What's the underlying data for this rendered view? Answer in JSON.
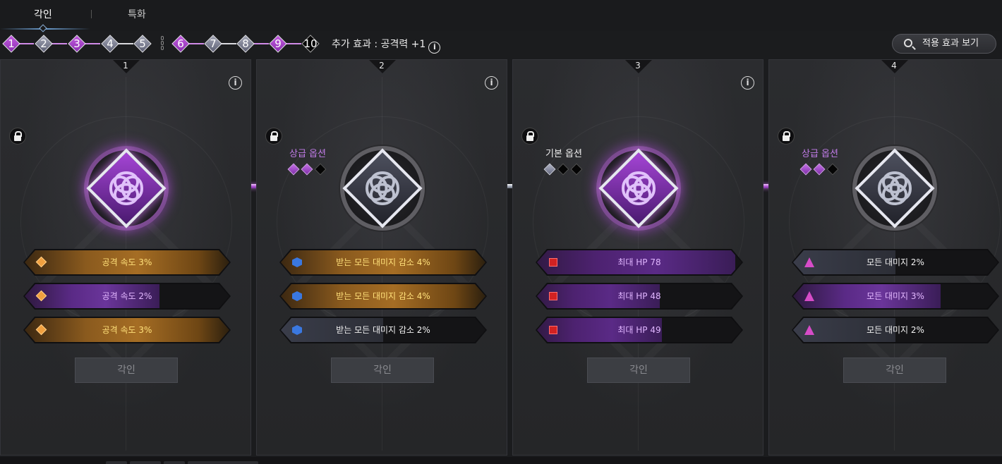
{
  "tabs": [
    {
      "label": "각인",
      "active": true
    },
    {
      "label": "특화",
      "active": false
    }
  ],
  "levels": [
    {
      "num": "1",
      "style": "purple"
    },
    {
      "num": "2",
      "style": "grey"
    },
    {
      "num": "3",
      "style": "purple"
    },
    {
      "num": "4",
      "style": "grey"
    },
    {
      "num": "5",
      "style": "grey"
    },
    {
      "num": "6",
      "style": "purple"
    },
    {
      "num": "7",
      "style": "grey"
    },
    {
      "num": "8",
      "style": "grey"
    },
    {
      "num": "9",
      "style": "purple"
    },
    {
      "num": "10",
      "style": "dark"
    }
  ],
  "bonus": {
    "text": "추가 효과 : 공격력 +1",
    "info": "i"
  },
  "view_button": {
    "label": "적용 효과 보기",
    "icon": "search-icon"
  },
  "panels": [
    {
      "number": "1",
      "info": "i",
      "locked": true,
      "option_label": "",
      "emblem": "purple",
      "gems": [],
      "rows": [
        {
          "text": "공격 속도 3%",
          "style": "gold",
          "icon": "diamond-icon",
          "fill": 1.0
        },
        {
          "text": "공격 속도 2%",
          "style": "violet",
          "icon": "diamond-icon",
          "fill": 0.66
        },
        {
          "text": "공격 속도 3%",
          "style": "gold",
          "icon": "diamond-icon",
          "fill": 1.0
        }
      ],
      "button": "각인"
    },
    {
      "number": "2",
      "info": "i",
      "locked": true,
      "option_label": "상급 옵션",
      "option_style": "hi",
      "emblem": "grey",
      "gems": [
        "p",
        "p",
        "k"
      ],
      "rows": [
        {
          "text": "받는 모든 대미지 감소 4%",
          "style": "gold",
          "icon": "hexagon-icon",
          "fill": 1.0
        },
        {
          "text": "받는 모든 대미지 감소 4%",
          "style": "gold",
          "icon": "hexagon-icon",
          "fill": 1.0
        },
        {
          "text": "받는 모든 대미지 감소 2%",
          "style": "plain",
          "icon": "hexagon-icon",
          "fill": 0.5
        }
      ],
      "button": "각인"
    },
    {
      "number": "3",
      "info": "i",
      "locked": true,
      "option_label": "기본 옵션",
      "option_style": "base",
      "emblem": "purple",
      "gems": [
        "g",
        "k",
        "k"
      ],
      "rows": [
        {
          "text": "최대 HP 78",
          "style": "red",
          "icon": "square-icon",
          "fill": 0.97
        },
        {
          "text": "최대 HP 48",
          "style": "red",
          "icon": "square-icon",
          "fill": 0.6
        },
        {
          "text": "최대 HP 49",
          "style": "red",
          "icon": "square-icon",
          "fill": 0.61
        }
      ],
      "button": "각인"
    },
    {
      "number": "4",
      "info": "",
      "locked": true,
      "option_label": "상급 옵션",
      "option_style": "hi",
      "emblem": "grey",
      "gems": [
        "p",
        "p",
        "k"
      ],
      "rows": [
        {
          "text": "모든 대미지 2%",
          "style": "plain",
          "icon": "triangle-icon",
          "fill": 0.5
        },
        {
          "text": "모든 대미지 3%",
          "style": "violet",
          "icon": "triangle-icon",
          "fill": 0.72
        },
        {
          "text": "모든 대미지 2%",
          "style": "plain",
          "icon": "triangle-icon",
          "fill": 0.5
        }
      ],
      "button": "각인"
    }
  ],
  "colors": {
    "purple_accent": "#b55ad8",
    "gold_accent": "#a56d24",
    "background": "#1b1c1e"
  }
}
